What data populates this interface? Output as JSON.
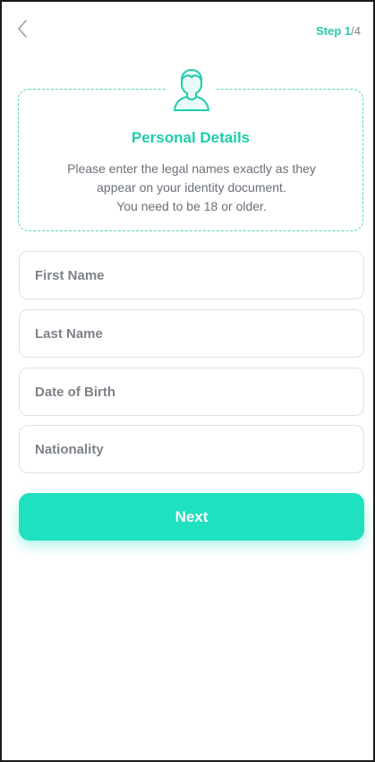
{
  "header": {
    "back_icon": "chevron-left-icon",
    "step_word": "Step",
    "step_current": "1",
    "step_separator": "/",
    "step_total": "4"
  },
  "info_card": {
    "icon": "user-avatar-icon",
    "title": "Personal Details",
    "description_lines": [
      "Please enter the legal names exactly as they",
      "appear on your identity document.",
      "You need to be 18 or older."
    ]
  },
  "form": {
    "first_name": {
      "placeholder": "First Name",
      "value": ""
    },
    "last_name": {
      "placeholder": "Last Name",
      "value": ""
    },
    "date_of_birth": {
      "placeholder": "Date of Birth",
      "value": ""
    },
    "nationality": {
      "placeholder": "Nationality",
      "value": ""
    }
  },
  "actions": {
    "next_label": "Next"
  },
  "colors": {
    "accent": "#1fcdaa",
    "button": "#1fe0bf",
    "text_muted": "#6b7079",
    "field_border": "#dde0e4"
  }
}
